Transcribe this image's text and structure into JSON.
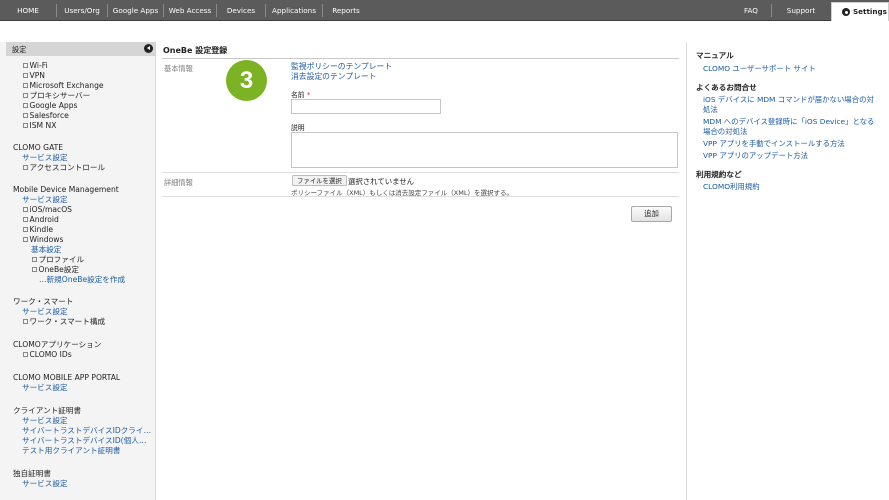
{
  "nav": {
    "items": [
      "HOME",
      "Users/Org",
      "Google Apps",
      "Web Access",
      "Devices",
      "Applications",
      "Reports"
    ],
    "faq": "FAQ",
    "support": "Support",
    "settings": "Settings"
  },
  "sidebar": {
    "header": "設定",
    "top_items": [
      "Wi-Fi",
      "VPN",
      "Microsoft Exchange",
      "プロキシサーバー",
      "Google Apps",
      "Salesforce",
      "ISM NX"
    ],
    "clomo_gate": {
      "title": "CLOMO GATE",
      "service": "サービス設定",
      "items": [
        "アクセスコントロール"
      ]
    },
    "mdm": {
      "title": "Mobile Device Management",
      "service": "サービス設定",
      "items": [
        "iOS/macOS",
        "Android",
        "Kindle",
        "Windows"
      ],
      "windows_basic": "基本設定",
      "windows_items": [
        "プロファイル",
        "OneBe設定"
      ],
      "new_onebe": "…新規OneBe設定を作成"
    },
    "work_smart": {
      "title": "ワーク・スマート",
      "service": "サービス設定",
      "items": [
        "ワーク・スマート構成"
      ]
    },
    "clomo_app": {
      "title": "CLOMOアプリケーション",
      "items": [
        "CLOMO IDs"
      ]
    },
    "portal": {
      "title": "CLOMO MOBILE APP PORTAL",
      "service": "サービス設定"
    },
    "client_cert": {
      "title": "クライアント証明書",
      "links": [
        "サービス設定",
        "サイバートラストデバイスIDクライ…",
        "サイバートラストデバイスID(個人…",
        "テスト用クライアント証明書"
      ]
    },
    "own_cert": {
      "title": "独自証明書",
      "service": "サービス設定"
    }
  },
  "main": {
    "title": "OneBe 設定登録",
    "basic_label": "基本情報",
    "template_links": [
      "監視ポリシーのテンプレート",
      "消去設定のテンプレート"
    ],
    "badge": "3",
    "name_label": "名前",
    "required_mark": "*",
    "desc_label": "説明",
    "detail_label": "詳細情報",
    "file_button": "ファイルを選択",
    "file_status": "選択されていません",
    "file_note": "ポリシーファイル（XML）もしくは消去設定ファイル（XML）を選択する。",
    "add_button": "追加"
  },
  "right": {
    "manual_title": "マニュアル",
    "manual_links": [
      "CLOMO ユーザーサポート サイト"
    ],
    "faq_title": "よくあるお問合せ",
    "faq_links": [
      "iOS デバイスに MDM コマンドが届かない場合の対",
      "処法",
      "MDM へのデバイス登録時に「iOS Device」となる",
      "場合の対処法",
      "VPP アプリを手動でインストールする方法",
      "VPP アプリのアップデート方法"
    ],
    "terms_title": "利用規約など",
    "terms_links": [
      "CLOMO利用規約"
    ]
  },
  "colors": {
    "nav_bg": "#5b5b5b",
    "link": "#1b5aa6",
    "badge": "#7bb324",
    "required": "#d4262f"
  }
}
